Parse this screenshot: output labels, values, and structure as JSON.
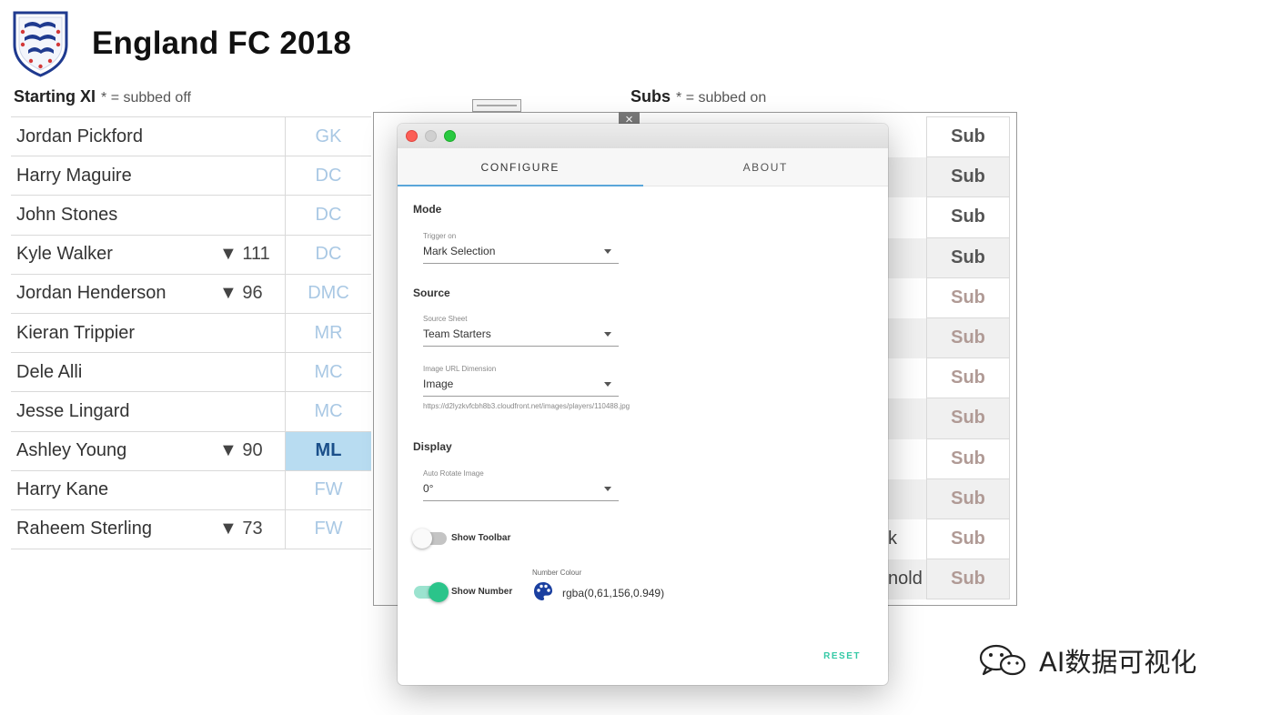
{
  "header": {
    "title": "England FC 2018"
  },
  "starting_xi": {
    "heading": "Starting XI",
    "note": "* = subbed off",
    "rows": [
      {
        "name": "Jordan Pickford",
        "sub": "",
        "pos": "GK",
        "selected": false
      },
      {
        "name": "Harry Maguire",
        "sub": "",
        "pos": "DC",
        "selected": false
      },
      {
        "name": "John Stones",
        "sub": "",
        "pos": "DC",
        "selected": false
      },
      {
        "name": "Kyle Walker",
        "sub": "▼ 111",
        "pos": "DC",
        "selected": false
      },
      {
        "name": "Jordan Henderson",
        "sub": "▼ 96",
        "pos": "DMC",
        "selected": false
      },
      {
        "name": "Kieran Trippier",
        "sub": "",
        "pos": "MR",
        "selected": false
      },
      {
        "name": "Dele Alli",
        "sub": "",
        "pos": "MC",
        "selected": false
      },
      {
        "name": "Jesse Lingard",
        "sub": "",
        "pos": "MC",
        "selected": false
      },
      {
        "name": "Ashley Young",
        "sub": "▼ 90",
        "pos": "ML",
        "selected": true
      },
      {
        "name": "Harry Kane",
        "sub": "",
        "pos": "FW",
        "selected": false
      },
      {
        "name": "Raheem Sterling",
        "sub": "▼ 73",
        "pos": "FW",
        "selected": false
      }
    ]
  },
  "subs": {
    "heading": "Subs",
    "note": "* = subbed on",
    "cells": [
      {
        "label": "Sub",
        "style": "strong",
        "alt": false
      },
      {
        "label": "Sub",
        "style": "strong",
        "alt": true
      },
      {
        "label": "Sub",
        "style": "strong",
        "alt": false
      },
      {
        "label": "Sub",
        "style": "strong",
        "alt": true
      },
      {
        "label": "Sub",
        "style": "faded",
        "alt": false
      },
      {
        "label": "Sub",
        "style": "faded",
        "alt": true
      },
      {
        "label": "Sub",
        "style": "faded",
        "alt": false
      },
      {
        "label": "Sub",
        "style": "faded",
        "alt": true
      },
      {
        "label": "Sub",
        "style": "faded",
        "alt": false
      },
      {
        "label": "Sub",
        "style": "faded",
        "alt": true
      },
      {
        "label": "Sub",
        "style": "faded",
        "alt": false
      },
      {
        "label": "Sub",
        "style": "faded",
        "alt": true
      }
    ],
    "name_fragments": [
      "k",
      "nold"
    ]
  },
  "close_icon": "×",
  "dialog": {
    "tabs": [
      {
        "label": "CONFIGURE",
        "active": true
      },
      {
        "label": "ABOUT",
        "active": false
      }
    ],
    "mode": {
      "label": "Mode",
      "trigger": {
        "label": "Trigger on",
        "value": "Mark Selection"
      }
    },
    "source": {
      "label": "Source",
      "sheet": {
        "label": "Source Sheet",
        "value": "Team Starters"
      },
      "image": {
        "label": "Image URL Dimension",
        "value": "Image",
        "hint": "https://d2lyzkvfcbh8b3.cloudfront.net/images/players/110488.jpg"
      }
    },
    "display": {
      "label": "Display",
      "rotate": {
        "label": "Auto Rotate Image",
        "value": "0°"
      },
      "show_toolbar": {
        "label": "Show Toolbar",
        "on": false
      },
      "show_number": {
        "label": "Show Number",
        "on": true
      },
      "number_colour": {
        "label": "Number Colour",
        "value": "rgba(0,61,156,0.949)"
      }
    },
    "reset_label": "RESET",
    "colors": {
      "accent": "#35c9a6",
      "tab_underline": "#5aa6d9",
      "palette": "#1a3fa0"
    }
  },
  "watermark": {
    "text": "AI数据可视化"
  }
}
